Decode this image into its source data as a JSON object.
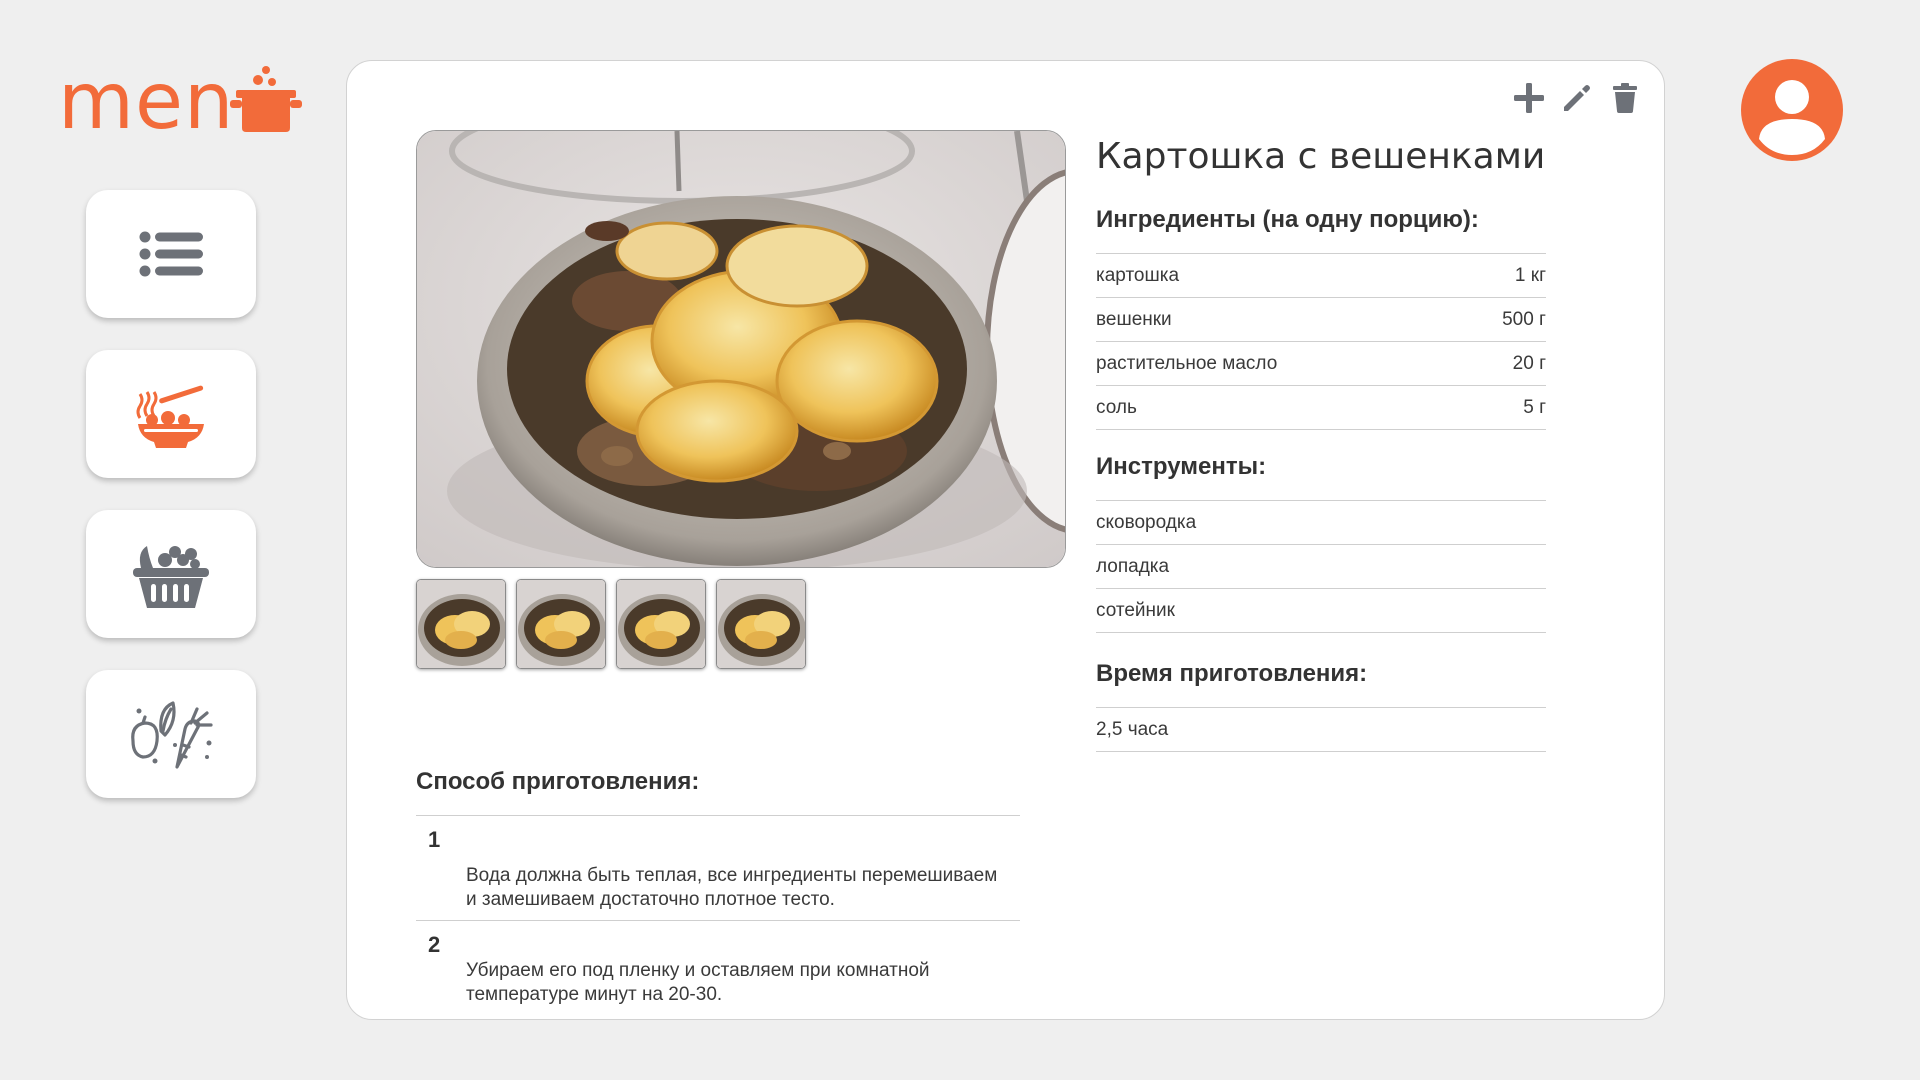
{
  "app": {
    "logo_text": "men",
    "brand_color": "#f26b3a",
    "icon_color": "#6d7178"
  },
  "sidebar": {
    "items": [
      {
        "name": "list",
        "icon": "list-icon"
      },
      {
        "name": "recipes",
        "icon": "noodle-bowl-icon"
      },
      {
        "name": "groceries",
        "icon": "basket-icon"
      },
      {
        "name": "products",
        "icon": "vegetables-icon"
      }
    ]
  },
  "toolbar": {
    "add_icon": "plus-icon",
    "edit_icon": "pencil-icon",
    "delete_icon": "trash-icon"
  },
  "recipe": {
    "title": "Картошка с вешенками",
    "ingredients_heading": "Ингредиенты (на одну порцию):",
    "ingredients": [
      {
        "name": "картошка",
        "amount": "1 кг"
      },
      {
        "name": "вешенки",
        "amount": "500 г"
      },
      {
        "name": "растительное масло",
        "amount": "20 г"
      },
      {
        "name": "соль",
        "amount": "5 г"
      }
    ],
    "tools_heading": "Инструменты:",
    "tools": [
      "сковородка",
      "лопадка",
      "сотейник"
    ],
    "time_heading": "Время приготовления:",
    "time": "2,5 часа",
    "method_heading": "Способ приготовления:",
    "steps": [
      {
        "num": "1",
        "text": "Вода должна быть теплая, все ингредиенты перемешиваем и замешиваем достаточно плотное тесто."
      },
      {
        "num": "2",
        "text": "Убираем его под пленку и оставляем при комнатной температуре минут на 20-30."
      }
    ]
  }
}
